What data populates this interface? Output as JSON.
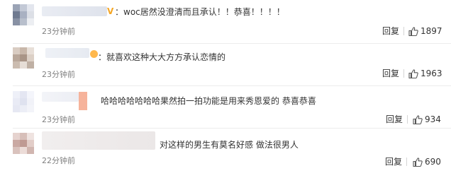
{
  "comments": [
    {
      "text": "：woc居然没澄清而且承认！！恭喜！！！！",
      "time": "23分钟前",
      "reply_label": "回复",
      "like_count": "1897",
      "avatar_colors": [
        "#9aa3b5",
        "#c3c9d6",
        "#e3e6ee",
        "#6f7a90",
        "#a9b1c2",
        "#dcdfe6",
        "#8891a4",
        "#b8bfcc",
        "#eceef2"
      ],
      "name_blur_colors": [
        "#e9ecf3",
        "#dfe3ec"
      ],
      "accent_color": "#f5a623"
    },
    {
      "text": "：就喜欢这种大大方方承认恋情的",
      "time": "23分钟前",
      "reply_label": "回复",
      "like_count": "1963",
      "avatar_colors": [
        "#d9ccc2",
        "#c8b7aa",
        "#e8dfd8",
        "#b9a79a",
        "#a99587",
        "#dcd0c6",
        "#cbbcb0",
        "#e6ddd6",
        "#bfb0a4"
      ],
      "name_blur_colors": [
        "#eef1f6",
        "#e6eaf1"
      ],
      "accent_color": "#ffb84d"
    },
    {
      "text": "哈哈哈哈哈哈哈果然拍一拍功能是用来秀恩爱的 恭喜恭喜",
      "time": "23分钟前",
      "reply_label": "回复",
      "like_count": "934",
      "avatar_colors": [
        "#eef0f8",
        "#e4e6f2",
        "#f4f5fb",
        "#e9ebf5",
        "#dfe2ef",
        "#f1f2f8",
        "#e6e8f3",
        "#eceef6",
        "#f3f4f9"
      ],
      "name_blur_colors": [
        "#f3f4f8",
        "#eceef4"
      ],
      "accent_color": "#f6b39b"
    },
    {
      "text": "对这样的男生有莫名好感 做法很男人",
      "time": "22分钟前",
      "reply_label": "回复",
      "like_count": "690",
      "avatar_colors": [
        "#e6d3cf",
        "#d7bfb9",
        "#efe3e0",
        "#caa9a3",
        "#bf9a93",
        "#e2cdc8",
        "#d9c2bd",
        "#ecdcd8",
        "#d1b6b0"
      ],
      "name_blur_colors": [
        "#f1eeee",
        "#ebe7e7"
      ],
      "accent_color": "#e8e8e8"
    }
  ]
}
